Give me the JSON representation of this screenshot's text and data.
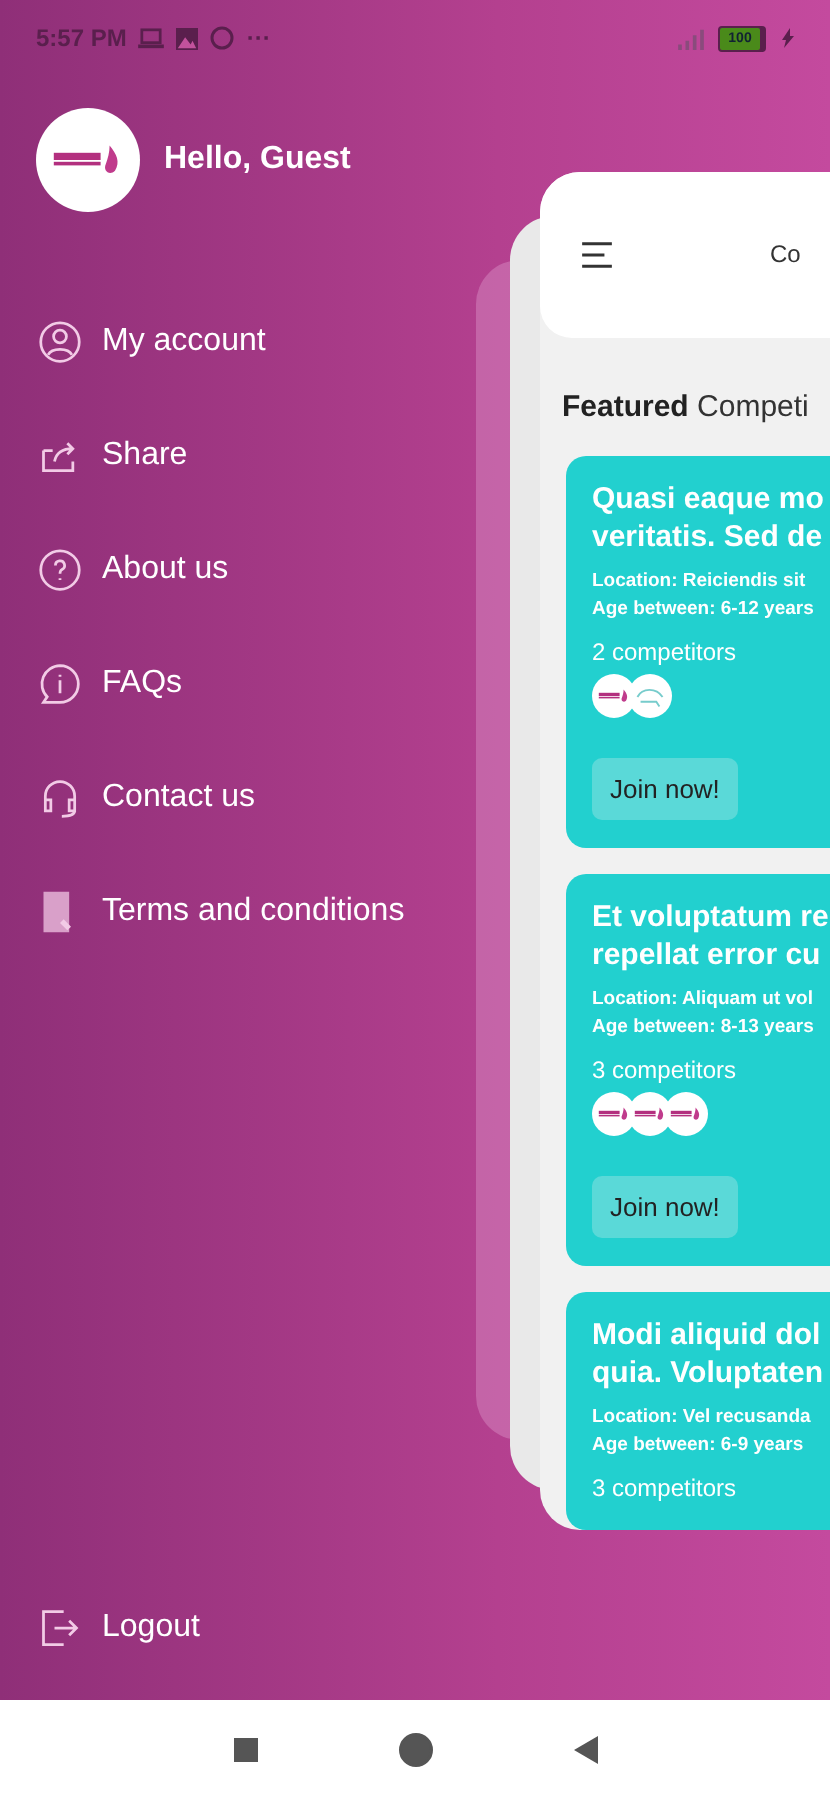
{
  "status_bar": {
    "time": "5:57 PM",
    "more": "···",
    "battery": "100"
  },
  "drawer": {
    "greeting": "Hello, Guest",
    "items": [
      {
        "kind": "account",
        "label": "My account"
      },
      {
        "kind": "share",
        "label": "Share"
      },
      {
        "kind": "about",
        "label": "About us"
      },
      {
        "kind": "faq",
        "label": "FAQs"
      },
      {
        "kind": "contact",
        "label": "Contact us"
      },
      {
        "kind": "terms",
        "label": "Terms and conditions"
      }
    ],
    "logout": "Logout"
  },
  "app_preview": {
    "header_title": "Co",
    "section_title": "**Featured** Competi",
    "cards": [
      {
        "title_lines": [
          "Quasi eaque mo",
          "veritatis. Sed de"
        ],
        "location": "Location: Reiciendis sit",
        "age": "Age between: 6-12 years",
        "competitors": "2 competitors",
        "avatars": [
          {
            "kind": "logo"
          },
          {
            "kind": "sketch"
          }
        ],
        "button": "Join now!"
      },
      {
        "title_lines": [
          "Et voluptatum re",
          "repellat error cu"
        ],
        "location": "Location: Aliquam ut vol",
        "age": "Age between: 8-13 years",
        "competitors": "3 competitors",
        "avatars": [
          {
            "kind": "logo"
          },
          {
            "kind": "logo"
          },
          {
            "kind": "logo"
          }
        ],
        "button": "Join now!"
      },
      {
        "title_lines": [
          "Modi aliquid dol",
          "quia. Voluptaten"
        ],
        "location": "Location: Vel recusanda",
        "age": "Age between: 6-9 years",
        "competitors": "3 competitors"
      }
    ]
  }
}
